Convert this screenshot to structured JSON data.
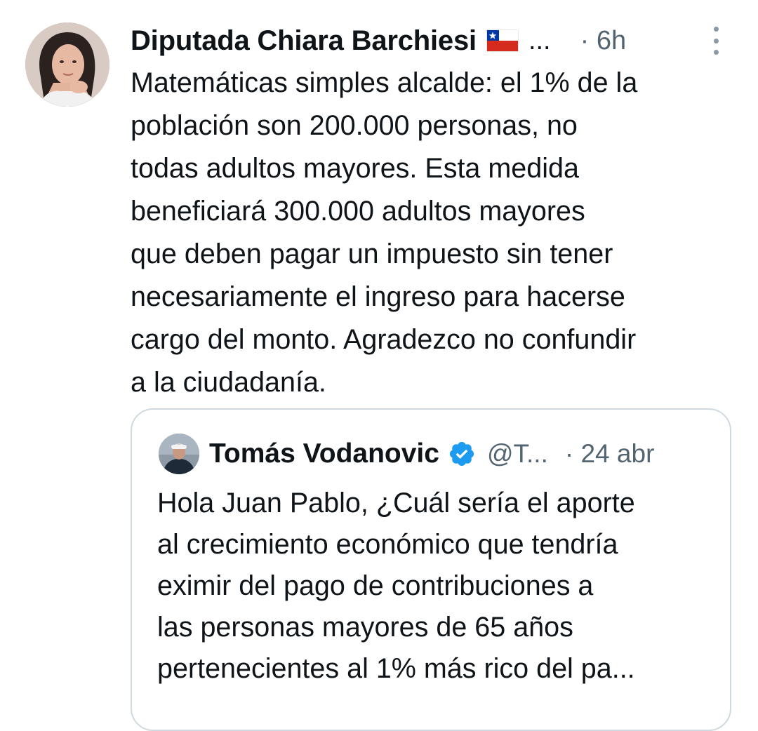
{
  "tweet": {
    "author": {
      "display_name": "Diputada Chiara Barchiesi",
      "flag_icon": "chile-flag-icon",
      "name_overflow": "...",
      "time": "· 6h"
    },
    "more_icon": "vertical-ellipsis-icon",
    "text": "Matemáticas simples alcalde: el 1% de la\npoblación son 200.000 personas, no\ntodas adultos mayores. Esta medida\nbeneficiará 300.000 adultos mayores\nque deben pagar un impuesto sin tener\nnecesariamente el ingreso para hacerse\ncargo del monto. Agradezco no confundir\na la ciudadanía.",
    "quoted": {
      "display_name": "Tomás Vodanovic",
      "verified_icon": "verified-badge-icon",
      "handle": "@T...",
      "date": "· 24 abr",
      "text": "Hola Juan Pablo, ¿Cuál sería el aporte\nal crecimiento económico que tendría\neximir del pago de contribuciones a\nlas personas mayores de 65 años\npertenecientes al 1% más rico del pa..."
    }
  },
  "colors": {
    "primary_text": "#0f1419",
    "secondary_text": "#536471",
    "border": "#cfd9de",
    "verified_blue": "#1d9bf0"
  }
}
